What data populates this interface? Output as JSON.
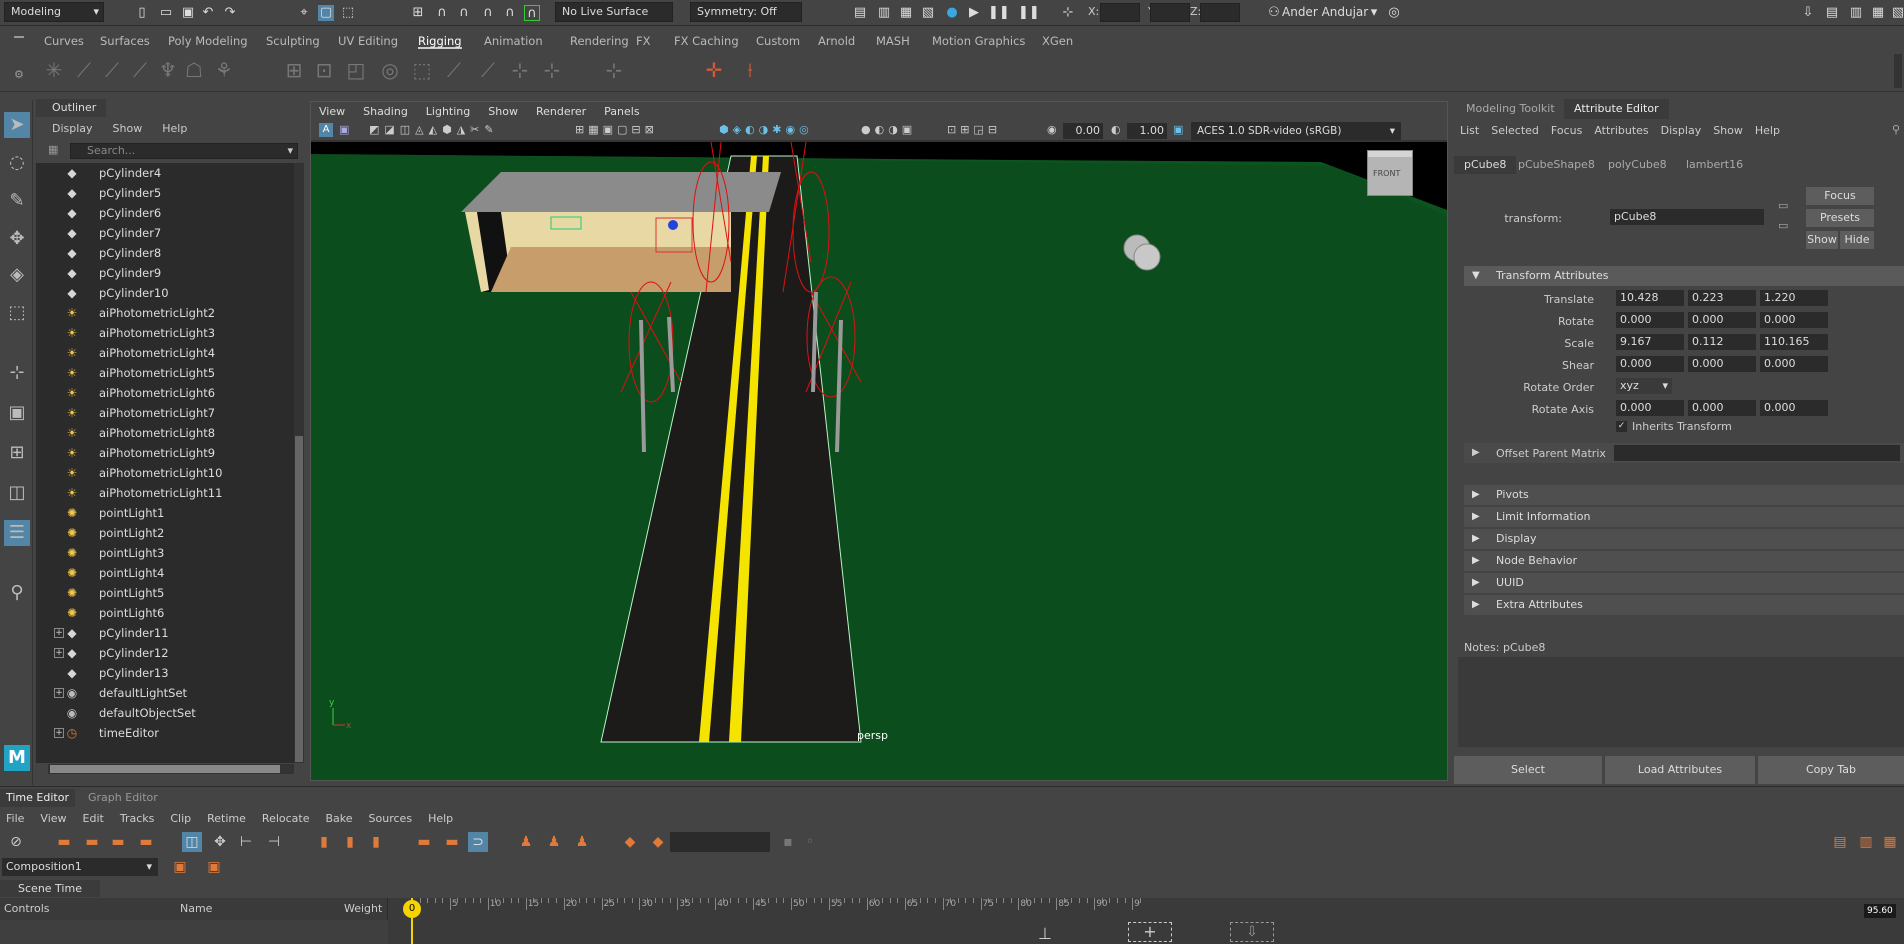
{
  "status_line": {
    "mode_menu": "Modeling",
    "live_surface": "No Live Surface",
    "symmetry": "Symmetry: Off",
    "x_label": "X:",
    "y_label": "Y:",
    "z_label": "Z:",
    "user": "Ander Andujar"
  },
  "shelf": {
    "tabs": [
      "Curves",
      "Surfaces",
      "Poly Modeling",
      "Sculpting",
      "UV Editing",
      "Rigging",
      "Animation",
      "Rendering",
      "FX",
      "FX Caching",
      "Custom",
      "Arnold",
      "MASH",
      "Motion Graphics",
      "XGen"
    ],
    "active_tab": "Rigging"
  },
  "outliner": {
    "title": "Outliner",
    "menu": [
      "Display",
      "Show",
      "Help"
    ],
    "search_placeholder": "Search...",
    "items": [
      {
        "label": "pCylinder4",
        "icon": "mesh-icon",
        "expand": false
      },
      {
        "label": "pCylinder5",
        "icon": "mesh-icon",
        "expand": false
      },
      {
        "label": "pCylinder6",
        "icon": "mesh-icon",
        "expand": false
      },
      {
        "label": "pCylinder7",
        "icon": "mesh-icon",
        "expand": false
      },
      {
        "label": "pCylinder8",
        "icon": "mesh-icon",
        "expand": false
      },
      {
        "label": "pCylinder9",
        "icon": "mesh-icon",
        "expand": false
      },
      {
        "label": "pCylinder10",
        "icon": "mesh-icon",
        "expand": false
      },
      {
        "label": "aiPhotometricLight2",
        "icon": "light-icon",
        "expand": false
      },
      {
        "label": "aiPhotometricLight3",
        "icon": "light-icon",
        "expand": false
      },
      {
        "label": "aiPhotometricLight4",
        "icon": "light-icon",
        "expand": false
      },
      {
        "label": "aiPhotometricLight5",
        "icon": "light-icon",
        "expand": false
      },
      {
        "label": "aiPhotometricLight6",
        "icon": "light-icon",
        "expand": false
      },
      {
        "label": "aiPhotometricLight7",
        "icon": "light-icon",
        "expand": false
      },
      {
        "label": "aiPhotometricLight8",
        "icon": "light-icon",
        "expand": false
      },
      {
        "label": "aiPhotometricLight9",
        "icon": "light-icon",
        "expand": false
      },
      {
        "label": "aiPhotometricLight10",
        "icon": "light-icon",
        "expand": false
      },
      {
        "label": "aiPhotometricLight11",
        "icon": "light-icon",
        "expand": false
      },
      {
        "label": "pointLight1",
        "icon": "point-light-icon",
        "expand": false
      },
      {
        "label": "pointLight2",
        "icon": "point-light-icon",
        "expand": false
      },
      {
        "label": "pointLight3",
        "icon": "point-light-icon",
        "expand": false
      },
      {
        "label": "pointLight4",
        "icon": "point-light-icon",
        "expand": false
      },
      {
        "label": "pointLight5",
        "icon": "point-light-icon",
        "expand": false
      },
      {
        "label": "pointLight6",
        "icon": "point-light-icon",
        "expand": false
      },
      {
        "label": "pCylinder11",
        "icon": "mesh-icon",
        "expand": true
      },
      {
        "label": "pCylinder12",
        "icon": "mesh-icon",
        "expand": true
      },
      {
        "label": "pCylinder13",
        "icon": "mesh-icon",
        "expand": false
      },
      {
        "label": "defaultLightSet",
        "icon": "set-icon",
        "expand": true
      },
      {
        "label": "defaultObjectSet",
        "icon": "set-icon",
        "expand": false
      },
      {
        "label": "timeEditor",
        "icon": "time-icon",
        "expand": true
      }
    ]
  },
  "viewport": {
    "menu": [
      "View",
      "Shading",
      "Lighting",
      "Show",
      "Renderer",
      "Panels"
    ],
    "field1": "0.00",
    "field2": "1.00",
    "color_space": "ACES 1.0 SDR-video (sRGB)",
    "camera_label": "persp",
    "viewcube_label": "FRONT",
    "colors": {
      "ground": "#0b4d1c",
      "sky": "#000000",
      "road": "#1d1a1a",
      "line": "#f5e400"
    }
  },
  "attribute_editor": {
    "tabs": [
      "Modeling Toolkit",
      "Attribute Editor"
    ],
    "active_tab": "Attribute Editor",
    "menu": [
      "List",
      "Selected",
      "Focus",
      "Attributes",
      "Display",
      "Show",
      "Help"
    ],
    "node_tabs": [
      "pCube8",
      "pCubeShape8",
      "polyCube8",
      "lambert16"
    ],
    "active_node_tab": "pCube8",
    "transform_label": "transform:",
    "transform_value": "pCube8",
    "buttons": {
      "focus": "Focus",
      "presets": "Presets",
      "show": "Show",
      "hide": "Hide"
    },
    "section_title": "Transform Attributes",
    "translate_label": "Translate",
    "translate": [
      "10.428",
      "0.223",
      "1.220"
    ],
    "rotate_label": "Rotate",
    "rotate": [
      "0.000",
      "0.000",
      "0.000"
    ],
    "scale_label": "Scale",
    "scale": [
      "9.167",
      "0.112",
      "110.165"
    ],
    "shear_label": "Shear",
    "shear": [
      "0.000",
      "0.000",
      "0.000"
    ],
    "rotate_order_label": "Rotate Order",
    "rotate_order": "xyz",
    "rotate_axis_label": "Rotate Axis",
    "rotate_axis": [
      "0.000",
      "0.000",
      "0.000"
    ],
    "inherits_transform": "Inherits Transform",
    "offset_parent_matrix": "Offset Parent Matrix",
    "collapsed_sections": [
      "Pivots",
      "Limit Information",
      "Display",
      "Node Behavior",
      "UUID",
      "Extra Attributes"
    ],
    "notes_label": "Notes:  pCube8",
    "bottom_buttons": [
      "Select",
      "Load Attributes",
      "Copy Tab"
    ]
  },
  "time_editor": {
    "tabs": [
      "Time Editor",
      "Graph Editor"
    ],
    "active_tab": "Time Editor",
    "menu": [
      "File",
      "View",
      "Edit",
      "Tracks",
      "Clip",
      "Retime",
      "Relocate",
      "Bake",
      "Sources",
      "Help"
    ],
    "composition": "Composition1",
    "scene_time": "Scene Time",
    "columns": [
      "Controls",
      "Name",
      "Weight"
    ],
    "current_frame": "0",
    "end_frame": "95.60",
    "ruler_labels": [
      "5",
      "10",
      "15",
      "20",
      "25",
      "30",
      "35",
      "40",
      "45",
      "50",
      "55",
      "60",
      "65",
      "70",
      "75",
      "80",
      "85",
      "90",
      "9"
    ]
  }
}
